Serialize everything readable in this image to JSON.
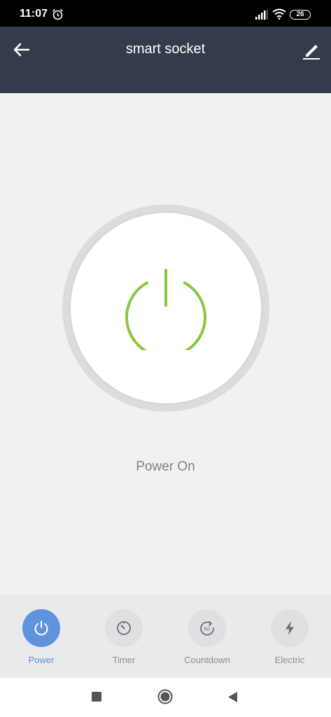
{
  "status_bar": {
    "time": "11:07",
    "battery": "26"
  },
  "header": {
    "title": "smart socket"
  },
  "main": {
    "status_text": "Power On"
  },
  "colors": {
    "header_bg": "#343c4c",
    "power_on": "#8cc63f",
    "accent": "#5f94dc"
  },
  "tabs": [
    {
      "label": "Power",
      "icon": "power-icon",
      "active": true
    },
    {
      "label": "Timer",
      "icon": "timer-icon",
      "active": false
    },
    {
      "label": "Countdown",
      "icon": "countdown-icon",
      "active": false
    },
    {
      "label": "Electric",
      "icon": "lightning-icon",
      "active": false
    }
  ],
  "nav": [
    "recents-square-icon",
    "home-circle-icon",
    "back-triangle-icon"
  ]
}
